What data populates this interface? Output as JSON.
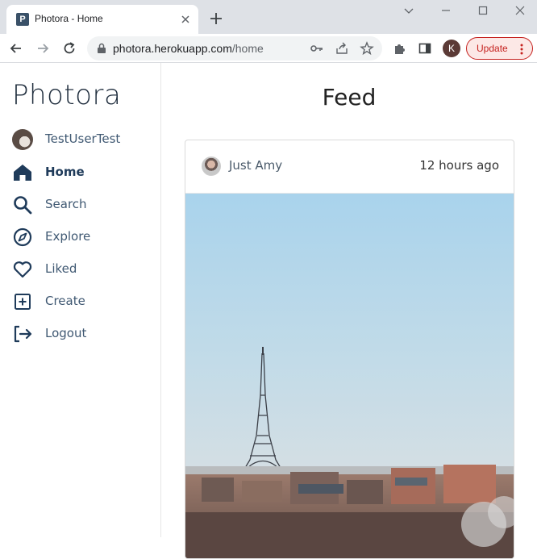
{
  "browser": {
    "tab_title": "Photora - Home",
    "tab_favicon_letter": "P",
    "url_domain": "photora.herokuapp.com",
    "url_path": "/home",
    "profile_initial": "K",
    "update_label": "Update"
  },
  "sidebar": {
    "brand": "Photora",
    "items": [
      {
        "label": "TestUserTest",
        "icon": "user-avatar"
      },
      {
        "label": "Home",
        "icon": "home-icon",
        "active": true
      },
      {
        "label": "Search",
        "icon": "search-icon"
      },
      {
        "label": "Explore",
        "icon": "compass-icon"
      },
      {
        "label": "Liked",
        "icon": "heart-icon"
      },
      {
        "label": "Create",
        "icon": "plus-square-icon"
      },
      {
        "label": "Logout",
        "icon": "logout-icon"
      }
    ]
  },
  "main": {
    "title": "Feed",
    "post": {
      "author": "Just Amy",
      "time": "12 hours ago"
    }
  },
  "colors": {
    "nav_text": "#3f5872",
    "nav_icon": "#1f3b5a",
    "update_accent": "#c5221f"
  }
}
